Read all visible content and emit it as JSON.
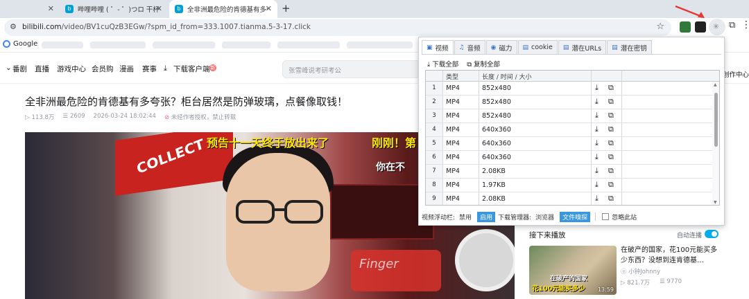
{
  "browser": {
    "tabs": [
      {
        "label": ""
      },
      {
        "label": "哔哩哔哩 ( ゜- ゜)つロ 干杯~-bi"
      },
      {
        "label": "全非洲最危险的肯德基有多夸张"
      }
    ],
    "url_domain": "bilibili.com",
    "url_path": "/video/BV1cuQzB3EGw/?spm_id_from=333.1007.tianma.5-3-17.click",
    "bookmark_google": "Google"
  },
  "site": {
    "nav": [
      "番剧",
      "直播",
      "游戏中心",
      "会员购",
      "漫画",
      "赛事",
      "下载客户端"
    ],
    "search_placeholder": "张雪峰说考研考公",
    "creator": "创作中心"
  },
  "video": {
    "title": "全非洲最危险的肯德基有多夸张？柜台居然是防弹玻璃，点餐像取钱！",
    "views": "113.8万",
    "danmaku": "2609",
    "date": "2026-03-24 18:02:44",
    "notice": "未经作者授权，禁止转载",
    "caption1": "预告十一天终于放出来了",
    "caption2": "刚刚！第",
    "caption3": "你在不",
    "sign_text": "COLLECT",
    "neon_text": "Finger"
  },
  "sidebar": {
    "up_next": "接下来播放",
    "autoplay": "自动连播",
    "rec": {
      "title": "在破产的国家，花100元能买多少东西？没想到连肯德基…",
      "up": "小钟Johnny",
      "views": "821.7万",
      "danmaku": "9770",
      "duration": "13:59",
      "thumb_text1": "在破产的国家",
      "thumb_text2": "花100元能买多少"
    }
  },
  "popup": {
    "tabs": [
      "视频",
      "音频",
      "磁力",
      "cookie",
      "潜在URLs",
      "潜在密钥"
    ],
    "actions": [
      "下载全部",
      "复制全部"
    ],
    "headers": {
      "type": "类型",
      "info": "长度 / 时间 / 大小"
    },
    "rows": [
      {
        "num": "1",
        "type": "MP4",
        "info": "852x480"
      },
      {
        "num": "2",
        "type": "MP4",
        "info": "852x480"
      },
      {
        "num": "3",
        "type": "MP4",
        "info": "852x480"
      },
      {
        "num": "4",
        "type": "MP4",
        "info": "640x360"
      },
      {
        "num": "5",
        "type": "MP4",
        "info": "640x360"
      },
      {
        "num": "6",
        "type": "MP4",
        "info": "640x360"
      },
      {
        "num": "7",
        "type": "MP4",
        "info": "2.08KB"
      },
      {
        "num": "8",
        "type": "MP4",
        "info": "1.97KB"
      },
      {
        "num": "9",
        "type": "MP4",
        "info": "2.08KB"
      }
    ],
    "footer": {
      "float_label": "视频浮动栏:",
      "disable": "禁用",
      "enable": "启用",
      "dl_manager_label": "下载管理器:",
      "browser": "浏览器",
      "file_sniffer": "文件嗅探",
      "ignore_site": "忽略此站"
    }
  },
  "colors": {
    "accent": "#3a96dd",
    "bili_blue": "#00aeec",
    "arrow": "#e53935"
  }
}
